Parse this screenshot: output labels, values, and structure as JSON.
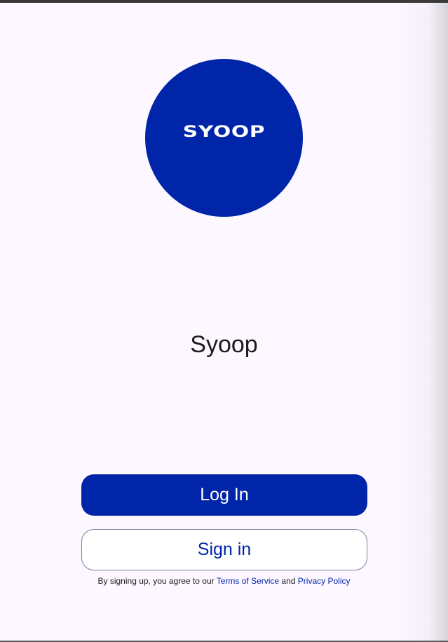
{
  "app": {
    "logo_text": "SYOOP",
    "title": "Syoop"
  },
  "actions": {
    "login_label": "Log In",
    "signin_label": "Sign in"
  },
  "legal": {
    "prefix": "By signing up, you agree to our ",
    "terms_label": "Terms of Service",
    "middle": " and ",
    "privacy_label": "Privacy Policy"
  },
  "colors": {
    "brand": "#0025a8",
    "background": "#fdf7ff",
    "text": "#1c1b1f"
  }
}
